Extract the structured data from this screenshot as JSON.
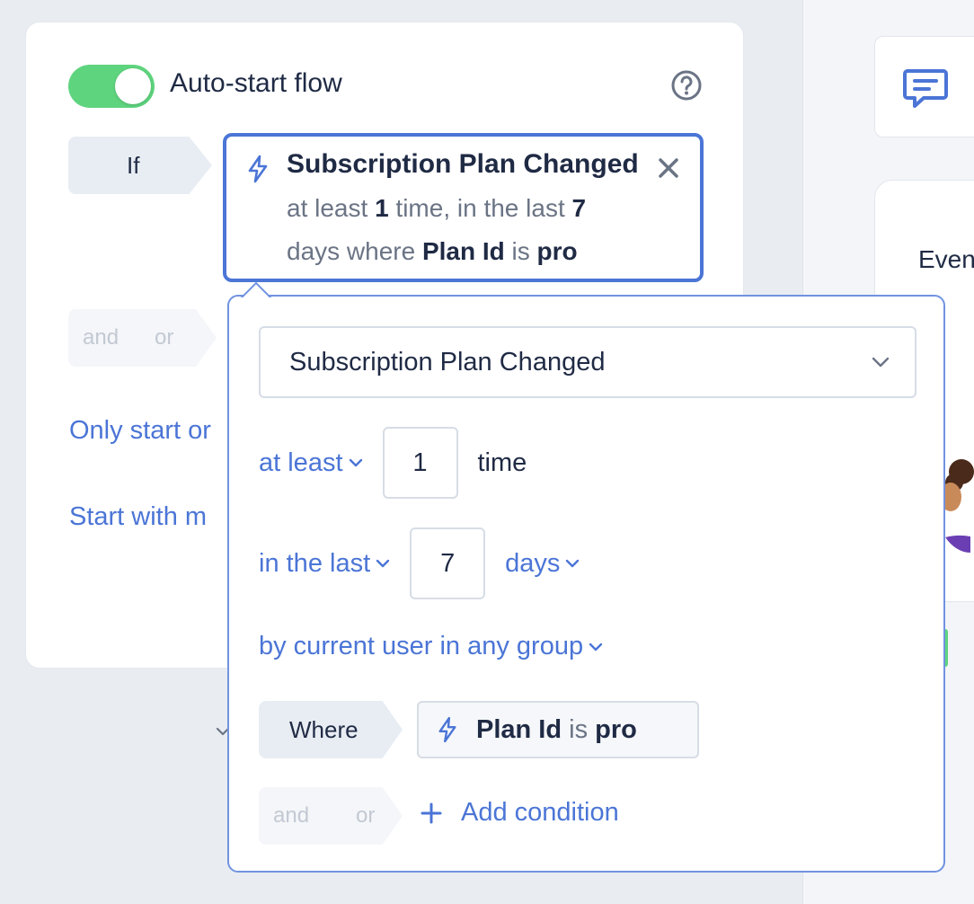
{
  "right_panel": {
    "card_text": "Even",
    "chat_icon": "chat-bubble-icon"
  },
  "flow": {
    "auto_start_label": "Auto-start flow",
    "toggle_on": true,
    "help_icon": "question-circle-icon",
    "if_label": "If",
    "condition": {
      "title": "Subscription Plan Changed",
      "line1_prefix": "at least ",
      "line1_count": "1",
      "line1_middle": " time, in the last ",
      "line1_days": "7",
      "line2_prefix": "days where ",
      "line2_property": "Plan Id",
      "line2_op": " is ",
      "line2_value": "pro"
    },
    "and_label": "and",
    "or_label": "or",
    "only_start_label": "Only start or",
    "start_with_label": "Start with m"
  },
  "popover": {
    "event_select": "Subscription Plan Changed",
    "frequency_label": "at least",
    "count_value": "1",
    "count_unit": "time",
    "window_label": "in the last",
    "window_value": "7",
    "window_unit": "days",
    "scope_label": "by current user in any group",
    "where_label": "Where",
    "where_property": "Plan Id",
    "where_op": "is",
    "where_value": "pro",
    "and_label": "and",
    "or_label": "or",
    "add_condition_label": "Add condition"
  },
  "colors": {
    "accent": "#4b75d6",
    "toggle_on": "#5fd47e",
    "text": "#1f2a44",
    "muted": "#6b7485"
  }
}
